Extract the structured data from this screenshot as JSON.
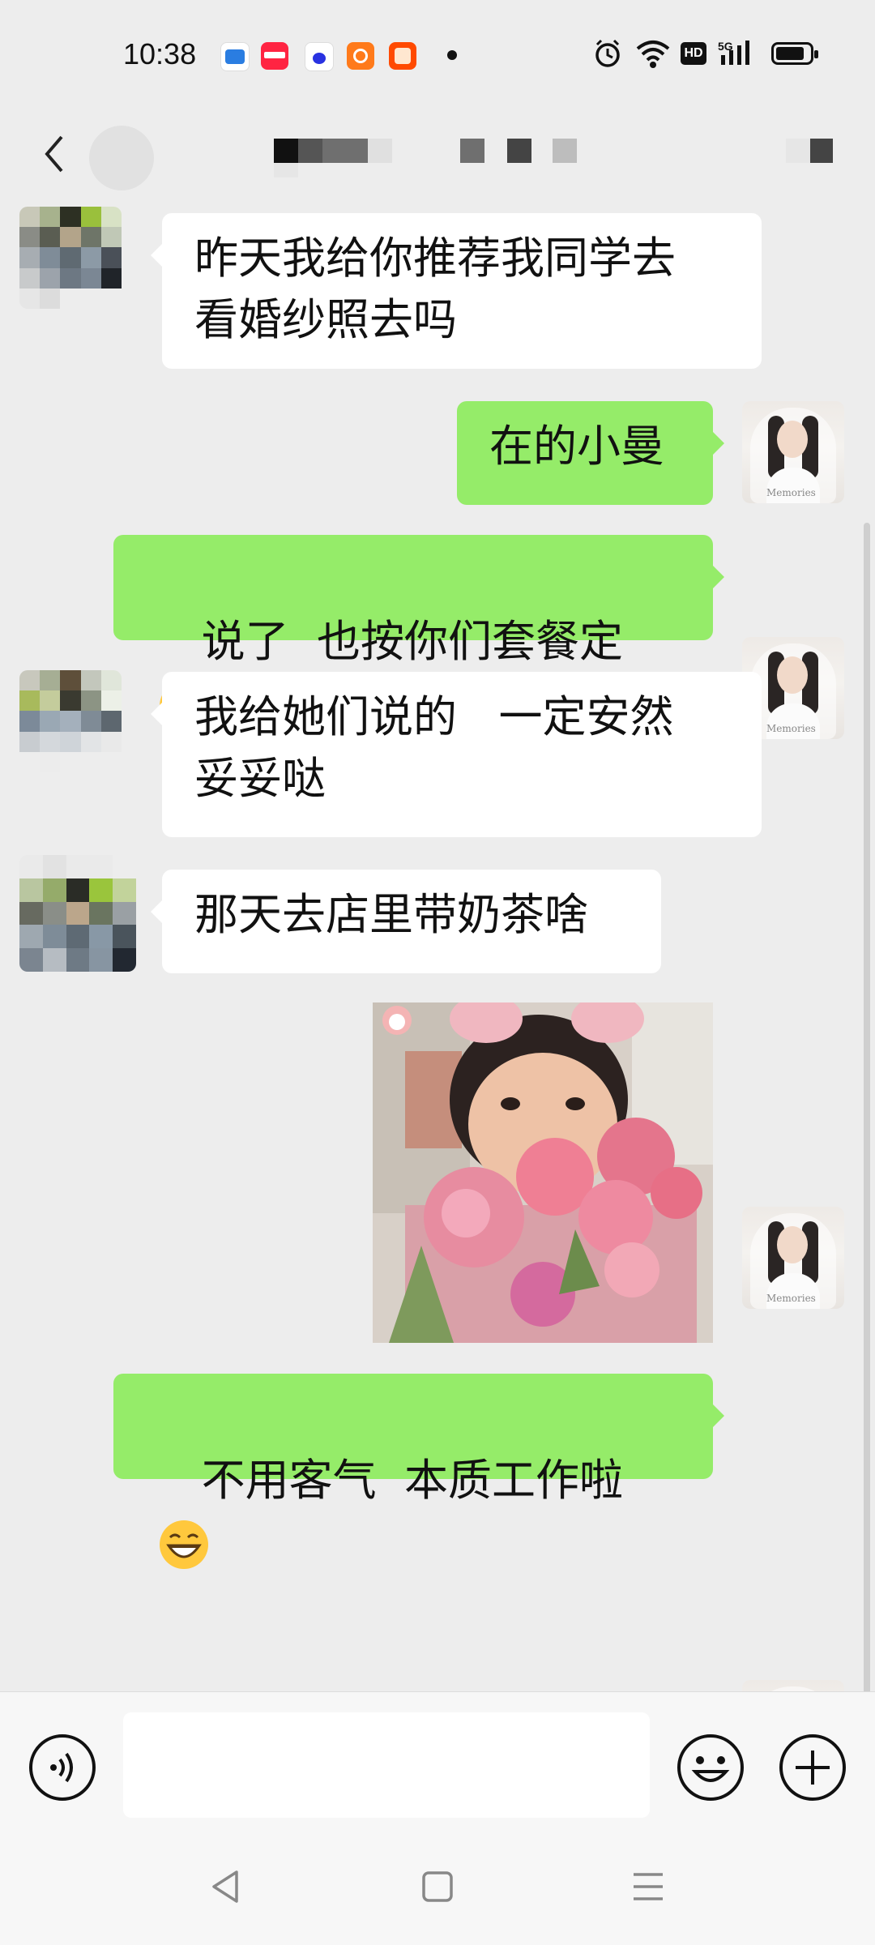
{
  "status_bar": {
    "time": "10:38",
    "app_icons": [
      "wallet-app-icon",
      "xiaohongshu-app-icon",
      "baidu-app-icon",
      "orange-app-icon",
      "taobao-app-icon"
    ],
    "indicators": [
      "alarm-icon",
      "wifi-icon",
      "hd-icon",
      "5g-signal-icon",
      "battery-icon"
    ]
  },
  "header": {
    "back_icon": "chevron-left-icon",
    "title_redacted": true
  },
  "messages": [
    {
      "side": "left",
      "text": "昨天我给你推荐我同学去\n看婚纱照去吗"
    },
    {
      "side": "right",
      "text": "在的小曼"
    },
    {
      "side": "right",
      "text": "说了  也按你们套餐定",
      "emoji": "shy-grin-emoji"
    },
    {
      "side": "left",
      "text": "我给她们说的   一定安然\n妥妥哒"
    },
    {
      "side": "left",
      "text": "那天去店里带奶茶啥"
    },
    {
      "side": "right",
      "type": "image",
      "description_icon": "photo-sticker"
    },
    {
      "side": "right",
      "text": "不用客气  本质工作啦",
      "emoji": "big-grin-emoji"
    }
  ],
  "input_bar": {
    "voice_icon": "voice-icon",
    "text_value": "",
    "emoji_icon": "smiley-icon",
    "plus_icon": "plus-icon"
  },
  "nav_bar": [
    "back-triangle-icon",
    "home-square-icon",
    "menu-lines-icon"
  ],
  "colors": {
    "background": "#ededed",
    "sent_bubble": "#95ec69",
    "received_bubble": "#ffffff",
    "bar": "#f7f7f7"
  }
}
